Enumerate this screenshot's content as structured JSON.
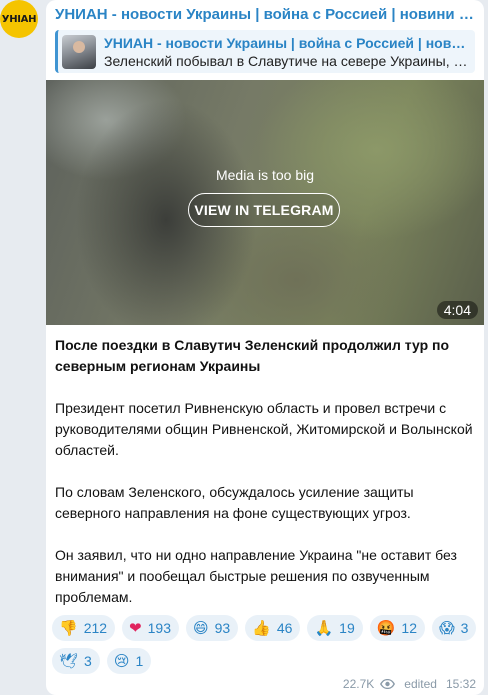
{
  "channel": {
    "avatar_text": "УНІАН",
    "name": "УНИАН - новости Украины | война с Россией | новини України | Україна",
    "accent_color": "#2a84c5",
    "avatar_color": "#f5c400"
  },
  "link_preview": {
    "title": "УНИАН - новости Украины | война с Россией | новини України | Україна",
    "description": "Зеленский побывал в Славутиче на севере Украины, проверил работу блокпостов"
  },
  "media": {
    "label": "Media is too big",
    "button_label": "VIEW IN TELEGRAM",
    "duration": "4:04"
  },
  "post": {
    "headline": "После поездки в Славутич Зеленский продолжил тур по северным регионам Украины",
    "paragraphs": [
      "Президент посетил Ривненскую область и провел встречи с руководителями общин Ривненской, Житомирской и Волынской областей.",
      "По словам Зеленского, обсуждалось усиление защиты северного направления на фоне существующих угроз.",
      "Он заявил, что ни одно направление Украина \"не оставит без внимания\" и пообещал быстрые решения по озвученным проблемам."
    ]
  },
  "reactions": [
    {
      "icon": "thumbs-down-icon",
      "emoji": "👎",
      "count": "212"
    },
    {
      "icon": "red-heart-icon",
      "emoji": "❤",
      "count": "193"
    },
    {
      "icon": "grinning-face-icon",
      "emoji": "😄",
      "count": "93"
    },
    {
      "icon": "thumbs-up-icon",
      "emoji": "👍",
      "count": "46"
    },
    {
      "icon": "folded-hands-icon",
      "emoji": "🙏",
      "count": "19"
    },
    {
      "icon": "angry-face-icon",
      "emoji": "🤬",
      "count": "12"
    },
    {
      "icon": "screaming-face-icon",
      "emoji": "😱",
      "count": "3"
    },
    {
      "icon": "dove-icon",
      "emoji": "🕊",
      "count": "3"
    },
    {
      "icon": "crying-face-icon",
      "emoji": "😢",
      "count": "1"
    }
  ],
  "meta": {
    "views": "22.7K",
    "edited": "edited",
    "time": "15:32"
  }
}
